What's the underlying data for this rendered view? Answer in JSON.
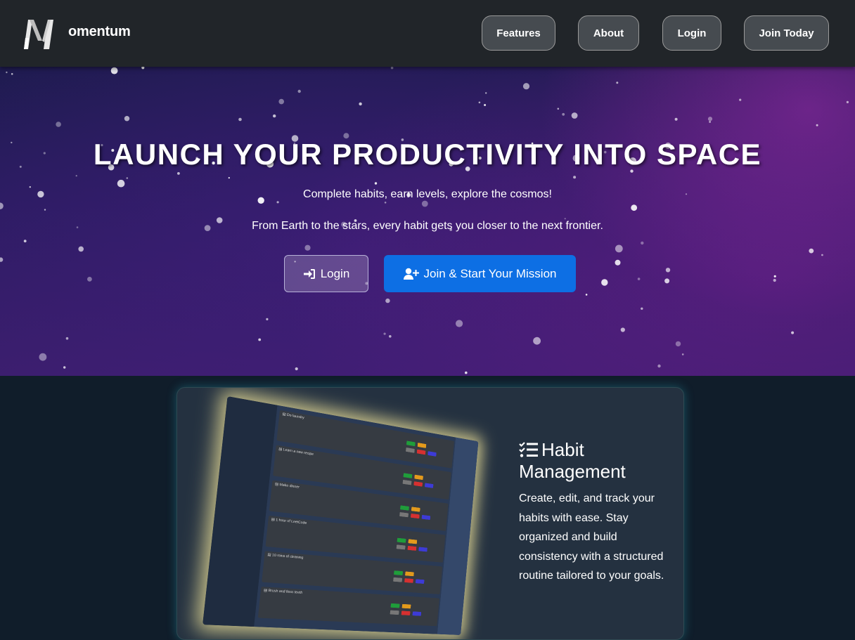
{
  "nav": {
    "brand": "omentum",
    "buttons": {
      "features": "Features",
      "about": "About",
      "login": "Login",
      "join": "Join Today"
    }
  },
  "hero": {
    "title": "LAUNCH YOUR PRODUCTIVITY INTO SPACE",
    "subtitle": "Complete habits, earn levels, explore the cosmos!",
    "tagline": "From Earth to the stars, every habit gets you closer to the next frontier.",
    "login_label": "Login",
    "join_label": "Join & Start Your Mission"
  },
  "feature": {
    "title": "Habit Management",
    "description": "Create, edit, and track your habits with ease. Stay organized and build consistency with a structured routine tailored to your goals.",
    "preview_rows": [
      "Do laundry",
      "Learn a new recipe",
      "Make dinner",
      "1 hour of LeetCode",
      "10 mins of cleaning",
      "Brush and floss teeth"
    ]
  },
  "colors": {
    "navbar": "#212529",
    "primary": "#0d6fe4",
    "card": "#243140",
    "page": "#101d2a"
  }
}
